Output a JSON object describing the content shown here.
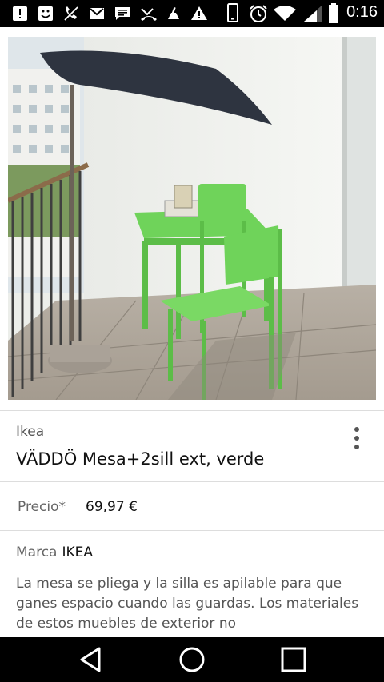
{
  "status_bar": {
    "time": "0:16",
    "left_icons": [
      "alert-box-icon",
      "smiley-icon",
      "muted-phone-icon",
      "gmail-icon",
      "message-icon",
      "missed-call-icon",
      "cleaner-icon",
      "warning-icon"
    ],
    "right_icons": [
      "phone-outline-icon",
      "alarm-icon",
      "wifi-icon",
      "signal-icon",
      "battery-icon"
    ]
  },
  "product": {
    "image_icon": "product-photo-table-chairs",
    "brand": "Ikea",
    "title": "VÄDDÖ Mesa+2sill ext, verde",
    "price_label": "Precio*",
    "price_value": "69,97 €",
    "brand_label": "Marca",
    "brand_value": "IKEA",
    "description": "La mesa se pliega y la silla es apilable para que ganes espacio cuando las guardas. Los materiales de estos muebles de exterior no"
  },
  "nav_bar": {
    "back_icon": "back-triangle-icon",
    "home_icon": "home-circle-icon",
    "recents_icon": "recents-square-icon"
  },
  "colors": {
    "status_bar": "#000000",
    "accent_green": "#6fd35a",
    "umbrella": "#2e3440"
  }
}
